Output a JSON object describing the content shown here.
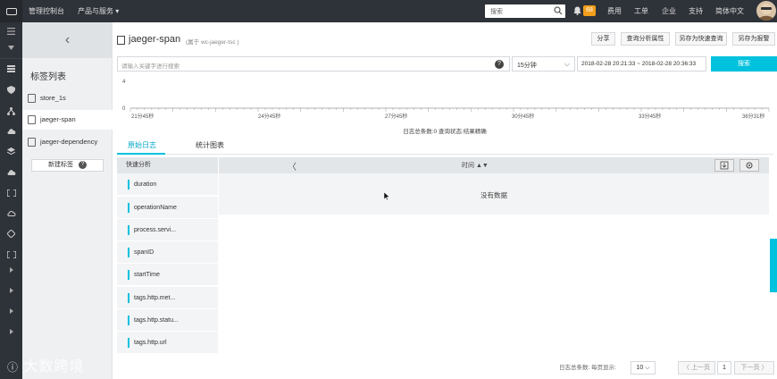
{
  "topbar": {
    "console": "管理控制台",
    "products": "产品与服务",
    "search_placeholder": "搜索",
    "notify_count": "68",
    "links": [
      "费用",
      "工单",
      "企业",
      "支持",
      "简体中文"
    ]
  },
  "sidebar": {
    "title": "标签列表",
    "items": [
      "store_1s",
      "jaeger-span",
      "jaeger-dependency"
    ],
    "new_tag": "新建标签",
    "help": "?"
  },
  "header": {
    "title": "jaeger-span",
    "subtitle": "(属于 wc-jaeger-tsc )",
    "buttons": [
      "分享",
      "查询分析属性",
      "另存为快速查询",
      "另存为报警"
    ]
  },
  "query": {
    "placeholder": "请输入关键字进行搜索",
    "help": "?",
    "interval": "15分钟",
    "interval_arrow": "⌵",
    "range": "2018-02-28 20:21:33 ~ 2018-02-28 20:36:33",
    "search": "搜索"
  },
  "chart_data": {
    "type": "bar",
    "y_ticks": [
      "4",
      "0"
    ],
    "x_ticks": [
      "21分45秒",
      "24分45秒",
      "27分45秒",
      "30分45秒",
      "33分45秒",
      "36分31秒"
    ],
    "values": []
  },
  "status": "日志总条数:0  查询状态:结果精确",
  "tabs": [
    "原始日志",
    "统计图表"
  ],
  "quick_analysis": {
    "title": "快速分析",
    "fields": [
      "duration",
      "operationName",
      "process.servi...",
      "spanID",
      "startTime",
      "tags.http.met...",
      "tags.http.statu...",
      "tags.http.url"
    ]
  },
  "grid": {
    "prev": "〈",
    "time_col": "时间 ▲▼",
    "empty": "没有数据"
  },
  "pagination": {
    "total_label": "日志总条数: 每页显示:",
    "page_size": "10 ⌵",
    "prev": "〈 上一页",
    "page": "1",
    "next": "下一页 〉"
  },
  "watermark": "大数跨境",
  "colors": {
    "accent": "#00c1de",
    "topbar": "#2e3239",
    "badge": "#f29d1b"
  }
}
